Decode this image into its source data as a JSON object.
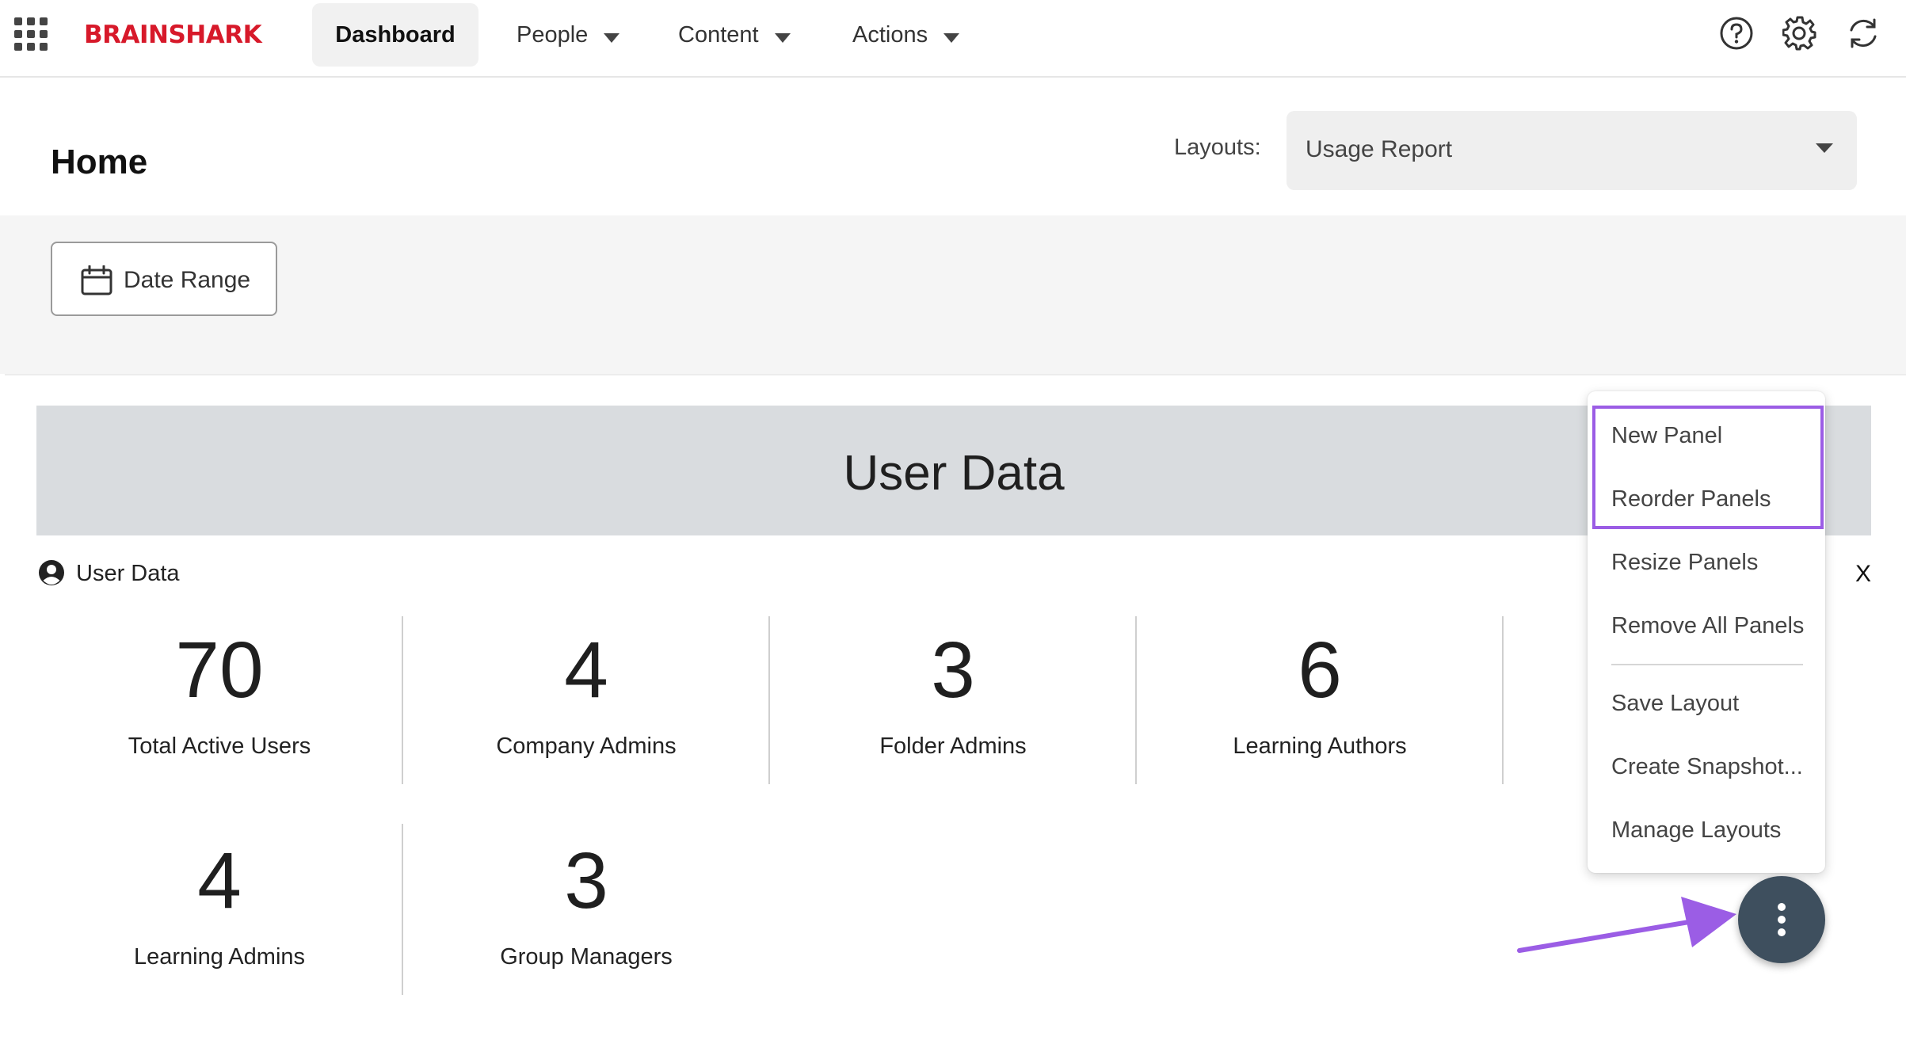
{
  "brand": {
    "logo_text": "BRAINSHARK",
    "logo_color": "#d7192a"
  },
  "nav": {
    "items": [
      {
        "label": "Dashboard",
        "active": true
      },
      {
        "label": "People",
        "has_dropdown": true
      },
      {
        "label": "Content",
        "has_dropdown": true
      },
      {
        "label": "Actions",
        "has_dropdown": true
      }
    ],
    "icons": [
      "apps-grid-icon",
      "help-icon",
      "gear-icon",
      "refresh-icon"
    ]
  },
  "header": {
    "title": "Home",
    "layouts_label": "Layouts:",
    "layouts_value": "Usage Report"
  },
  "filters": {
    "date_range_label": "Date Range"
  },
  "panel": {
    "banner_title": "User Data",
    "header_label": "User Data",
    "close_label": "X",
    "stats": [
      {
        "value": "70",
        "label": "Total Active Users"
      },
      {
        "value": "4",
        "label": "Company Admins"
      },
      {
        "value": "3",
        "label": "Folder Admins"
      },
      {
        "value": "6",
        "label": "Learning Authors"
      },
      {
        "value": "4",
        "label": "Learning Admins"
      },
      {
        "value": "3",
        "label": "Group Managers"
      }
    ]
  },
  "menu": {
    "items": [
      "New Panel",
      "Reorder Panels",
      "Resize Panels",
      "Remove All Panels",
      "Save Layout",
      "Create Snapshot...",
      "Manage Layouts"
    ]
  },
  "colors": {
    "highlight": "#9b5de5",
    "fab_background": "#3e4f5e",
    "banner_background": "#d9dcdf"
  }
}
